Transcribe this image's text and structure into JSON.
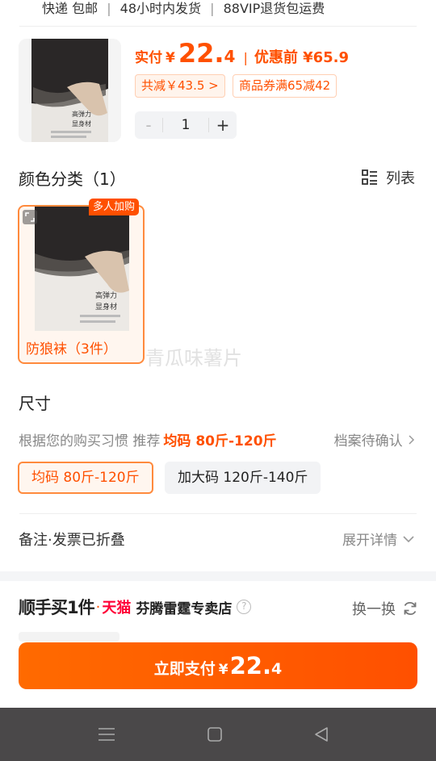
{
  "service": {
    "items": [
      "快递 包邮",
      "48小时内发货",
      "88VIP退货包运费"
    ]
  },
  "product": {
    "pay_label": "实付",
    "currency": "¥",
    "price_int": "22.",
    "price_dec": "4",
    "original_label": "优惠前 ¥65.9",
    "discount_chip": "共减￥43.5 >",
    "coupon_chip": "商品券满65减42",
    "quantity": "1",
    "minus": "-",
    "plus": "+",
    "thumb_text": [
      "高弹力",
      "显身材"
    ]
  },
  "color_section": {
    "title": "颜色分类（1）",
    "list_toggle": "列表",
    "variant_label": "防狼袜（3件）",
    "badge": "多人加购",
    "watermark": "青瓜味薯片"
  },
  "size_section": {
    "title": "尺寸",
    "recommend_prefix": "根据您的购买习惯 推荐",
    "recommend_value": "均码 80斤-120斤",
    "profile_link": "档案待确认",
    "options": [
      {
        "label": "均码 80斤-120斤",
        "selected": true
      },
      {
        "label": "加大码 120斤-140斤",
        "selected": false
      }
    ]
  },
  "remark": {
    "label": "备注·发票已折叠",
    "expand": "展开详情"
  },
  "buy_more": {
    "title": "顺手买1件",
    "dot": "·",
    "tmall": "天猫",
    "shop": "芬腾雷霆专卖店",
    "swap": "换一换"
  },
  "pay_button": {
    "label": "立即支付",
    "currency": "¥",
    "price_int": "22.",
    "price_dec": "4"
  },
  "colors": {
    "accent": "#ff5000",
    "nav_bar": "#4a4849"
  },
  "icons": [
    "list-icon",
    "chevron-right-icon",
    "chevron-down-icon",
    "help-icon",
    "refresh-icon",
    "expand-icon",
    "menu-icon",
    "home-icon",
    "back-icon"
  ]
}
